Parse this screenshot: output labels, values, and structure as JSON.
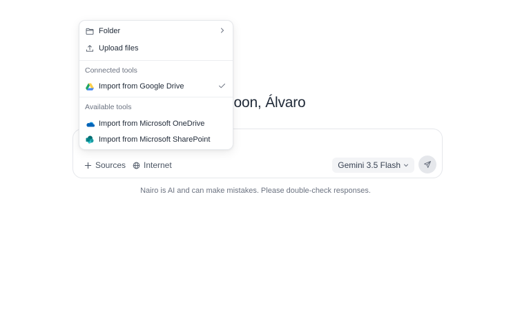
{
  "greeting": {
    "text": "fternoon, Álvaro"
  },
  "composer": {
    "placeholder": "",
    "sources_label": "Sources",
    "internet_label": "Internet",
    "model_label": "Gemini 3.5 Flash"
  },
  "disclaimer": "Nairo is AI and can make mistakes. Please double-check responses.",
  "menu": {
    "folder_label": "Folder",
    "upload_label": "Upload files",
    "connected_heading": "Connected tools",
    "google_drive_label": "Import from Google Drive",
    "available_heading": "Available tools",
    "onedrive_label": "Import from Microsoft OneDrive",
    "sharepoint_label": "Import from Microsoft SharePoint"
  },
  "colors": {
    "onedrive": "#0364b8",
    "sharepoint": "#038387",
    "gdrive_green": "#1fa463",
    "gdrive_yellow": "#ffd04b",
    "gdrive_blue": "#4688f4"
  }
}
